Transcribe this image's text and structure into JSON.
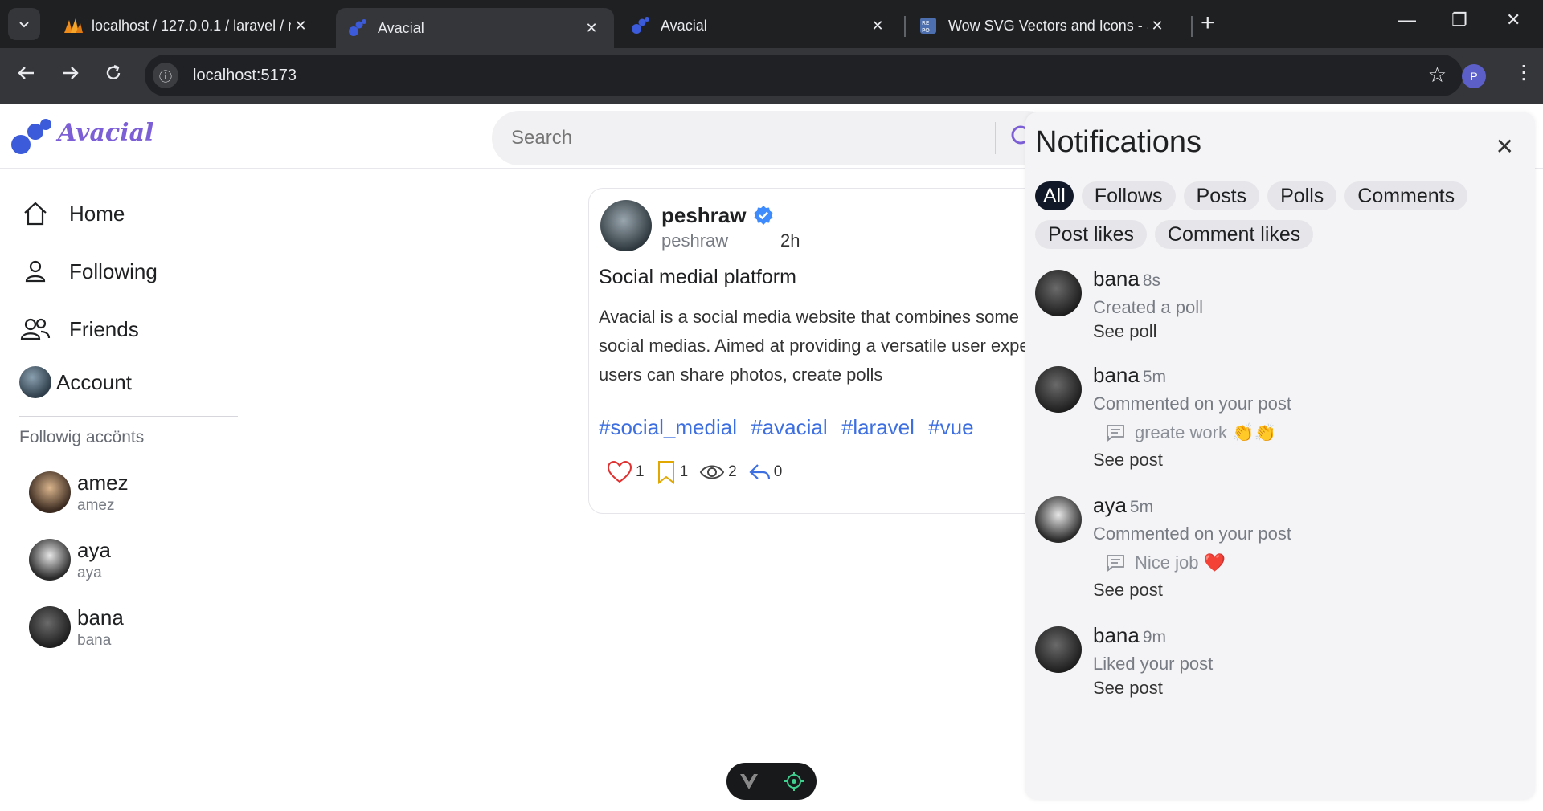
{
  "browser": {
    "tabs": [
      {
        "title": "localhost / 127.0.0.1 / laravel / r",
        "active": false
      },
      {
        "title": "Avacial",
        "active": true
      },
      {
        "title": "Avacial",
        "active": false
      },
      {
        "title": "Wow SVG Vectors and Icons - S",
        "active": false
      }
    ],
    "tab_close": "✕",
    "new_tab": "+",
    "url": "localhost:5173",
    "profile_initial": "P",
    "window_controls": {
      "minimize": "—",
      "restore": "❐",
      "close": "✕"
    }
  },
  "app": {
    "brand": "Avacial",
    "search_placeholder": "Search",
    "accent": "#3b5bdb"
  },
  "sidebar": {
    "nav": [
      {
        "label": "Home",
        "icon": "home-icon"
      },
      {
        "label": "Following",
        "icon": "user-icon"
      },
      {
        "label": "Friends",
        "icon": "friends-icon"
      },
      {
        "label": "Account",
        "icon": "account-avatar"
      }
    ],
    "following_title": "Followig accönts",
    "following": [
      {
        "name": "amez",
        "handle": "amez"
      },
      {
        "name": "aya",
        "handle": "aya"
      },
      {
        "name": "bana",
        "handle": "bana"
      }
    ]
  },
  "post": {
    "author": "peshraw",
    "handle": "peshraw",
    "time": "2h",
    "title": "Social medial platform",
    "body": "Avacial is a social media website that combines some of the popular social medias. Aimed at providing a versatile user experience where users can share photos, create polls",
    "tags": [
      "#social_medial",
      "#avacial",
      "#laravel",
      "#vue"
    ],
    "likes": "1",
    "bookmarks": "1",
    "views": "2",
    "shares": "0"
  },
  "notifications": {
    "title": "Notifications",
    "filters": [
      "All",
      "Follows",
      "Posts",
      "Polls",
      "Comments",
      "Post likes",
      "Comment likes"
    ],
    "active_filter": "All",
    "items": [
      {
        "name": "bana",
        "time": "8s",
        "action": "Created a poll",
        "comment": "",
        "link": "See poll"
      },
      {
        "name": "bana",
        "time": "5m",
        "action": "Commented on your post",
        "comment": "greate work 👏👏",
        "link": "See post"
      },
      {
        "name": "aya",
        "time": "5m",
        "action": "Commented on your post",
        "comment": "Nice job ❤️",
        "link": "See post"
      },
      {
        "name": "bana",
        "time": "9m",
        "action": "Liked your post",
        "comment": "",
        "link": "See post"
      }
    ]
  }
}
